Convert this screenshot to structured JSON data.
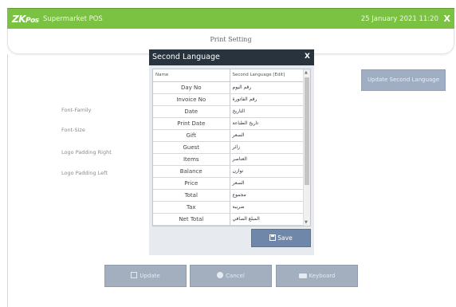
{
  "topbar": {
    "brand_zk": "ZK",
    "brand_pos": "Pos",
    "app_name": "Supermarket POS",
    "datetime": "25 January 2021 11:20",
    "close_label": "X"
  },
  "header": {
    "title": "Print Setting"
  },
  "settings": {
    "labels": [
      "Font-Family",
      "Font-Size",
      "Logo Padding Right",
      "Logo Padding Left"
    ]
  },
  "update_second_language_label": "Update Second Language",
  "modal": {
    "title": "Second Language",
    "close_label": "X",
    "columns": {
      "name": "Name",
      "value": "Second Language [Edit]"
    },
    "rows": [
      {
        "name": "Day No",
        "value": "رقم اليوم"
      },
      {
        "name": "Invoice No",
        "value": "رقم الفاتورة"
      },
      {
        "name": "Date",
        "value": "التاريخ"
      },
      {
        "name": "Print Date",
        "value": "تاريخ الطباعة"
      },
      {
        "name": "Gift",
        "value": "السعر"
      },
      {
        "name": "Guest",
        "value": "زائر"
      },
      {
        "name": "Items",
        "value": "العناصر"
      },
      {
        "name": "Balance",
        "value": "توازن"
      },
      {
        "name": "Price",
        "value": "السعر"
      },
      {
        "name": "Total",
        "value": "مجموع"
      },
      {
        "name": "Tax",
        "value": "ضريبة"
      },
      {
        "name": "Net Total",
        "value": "المبلغ الصافي"
      }
    ],
    "save_label": "Save"
  },
  "footer": {
    "update_label": "Update",
    "cancel_label": "Cancel",
    "keyboard_label": "Keyboard"
  },
  "icons": {
    "save": "floppy-disk-icon",
    "cancel": "circle-icon",
    "keyboard": "keyboard-icon"
  },
  "colors": {
    "topbar": "#7bc142",
    "modal_header": "#28333d",
    "save_button": "#6f87a8",
    "disabled_button": "#a3afbe"
  }
}
